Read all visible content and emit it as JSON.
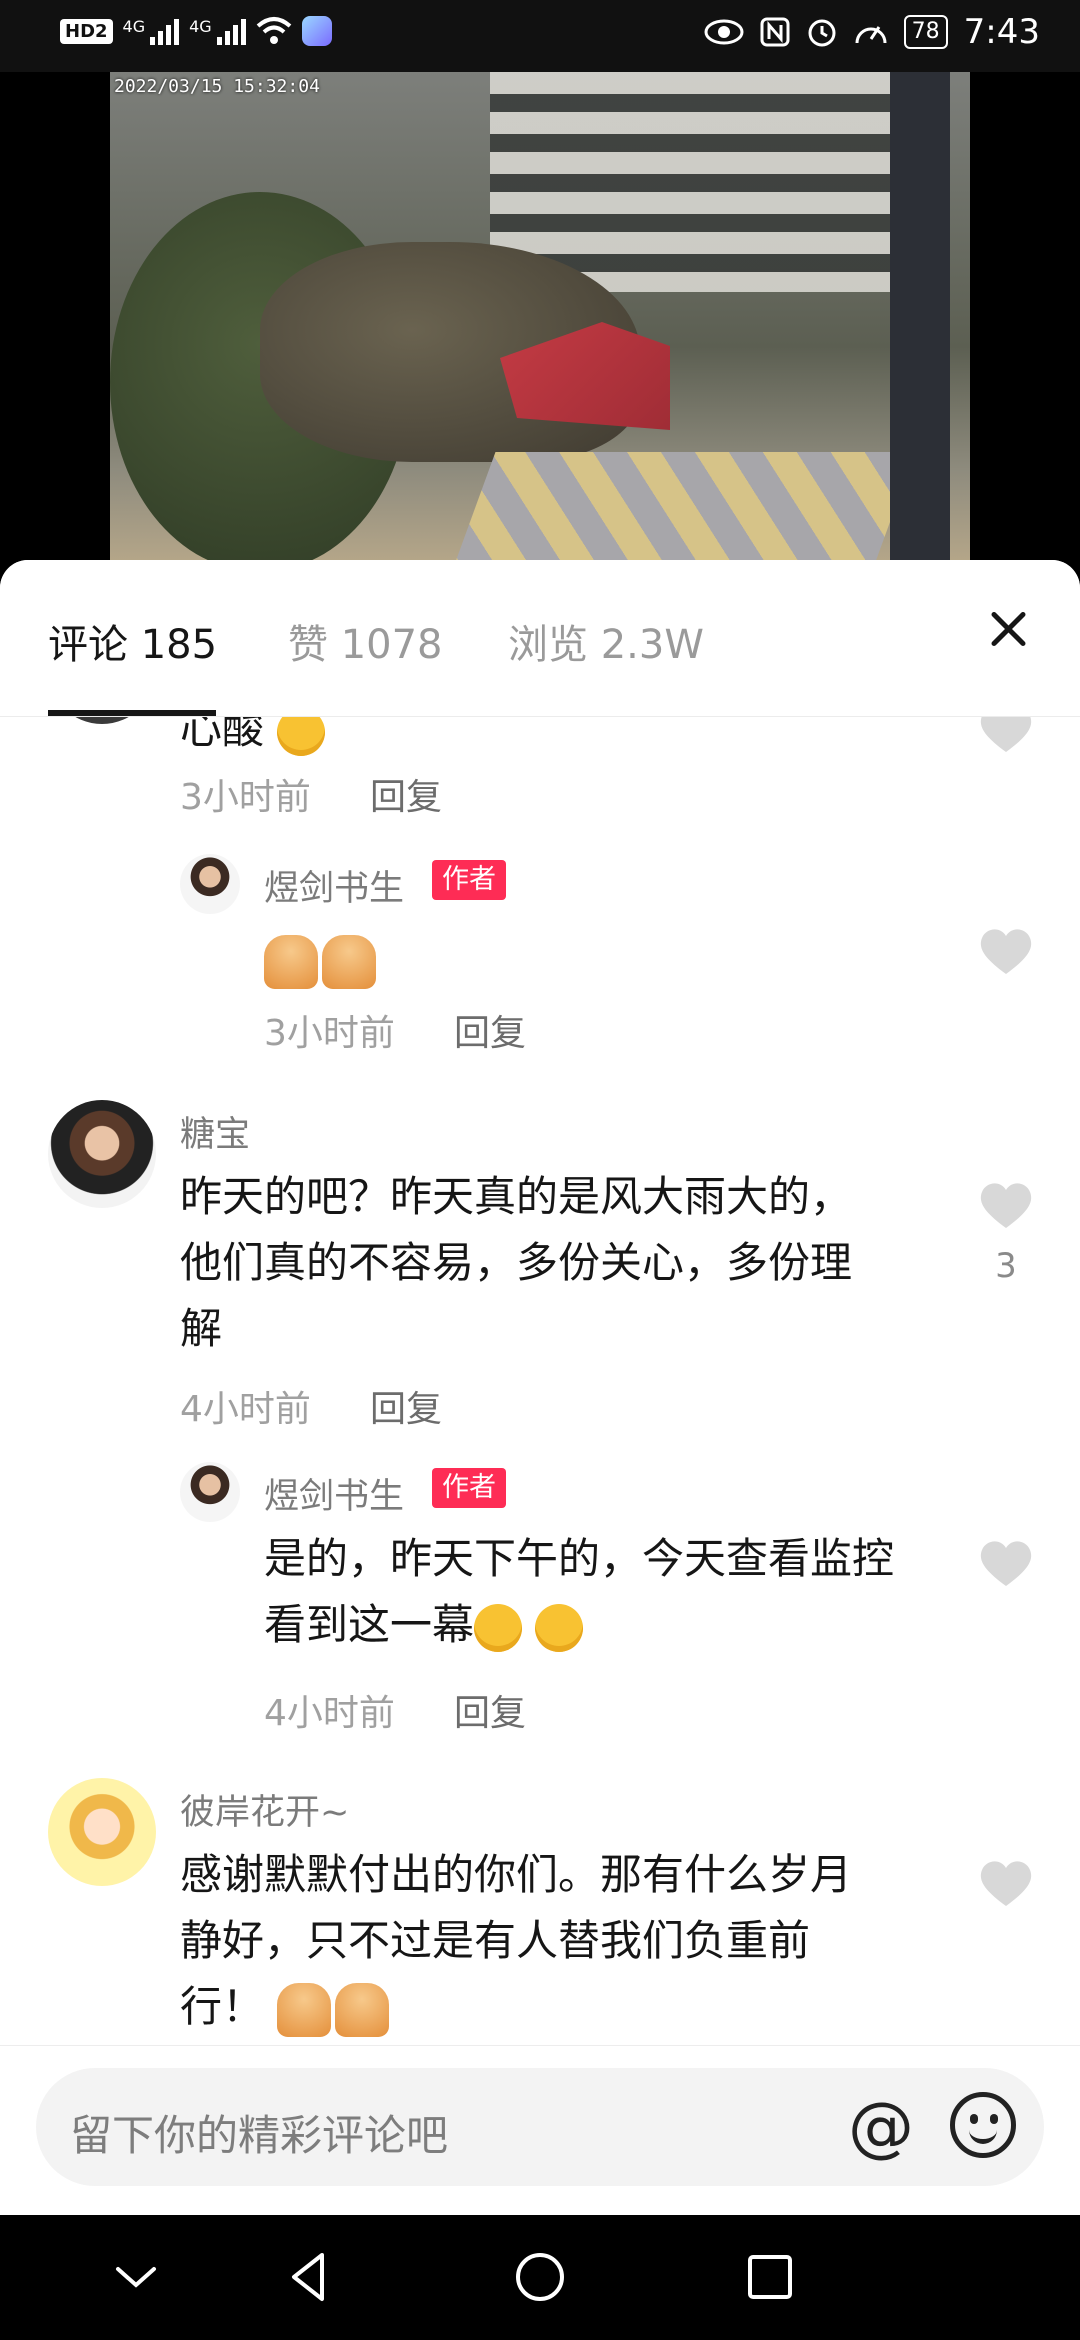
{
  "status_bar": {
    "time": "7:43",
    "battery": "78",
    "hd_label": "HD",
    "sim_label": "2",
    "network1": "4G",
    "network2": "4G"
  },
  "video": {
    "timestamp": "2022/03/15  15:32:04"
  },
  "tabs": {
    "comments": "评论 185",
    "likes": "赞 1078",
    "views": "浏览 2.3W"
  },
  "comments": [
    {
      "text": "心酸",
      "time": "3小时前",
      "reply": "回复"
    },
    {
      "name": "煜剑书生",
      "tag": "作者",
      "time": "3小时前",
      "reply": "回复"
    },
    {
      "name": "糖宝",
      "text_line1": "昨天的吧？昨天真的是风大雨大的，",
      "text_line2": "他们真的不容易，多份关心，多份理",
      "text_line3": "解",
      "likes": "3",
      "time": "4小时前",
      "reply": "回复"
    },
    {
      "name": "煜剑书生",
      "tag": "作者",
      "text_line1": "是的，昨天下午的，今天查看监控",
      "text_line2": "看到这一幕",
      "time": "4小时前",
      "reply": "回复"
    },
    {
      "name": "彼岸花开~",
      "text_line1": "感谢默默付出的你们。那有什么岁月",
      "text_line2": "静好，只不过是有人替我们负重前",
      "text_line3": "行！"
    }
  ],
  "input": {
    "placeholder": "留下你的精彩评论吧",
    "at_symbol": "@"
  }
}
